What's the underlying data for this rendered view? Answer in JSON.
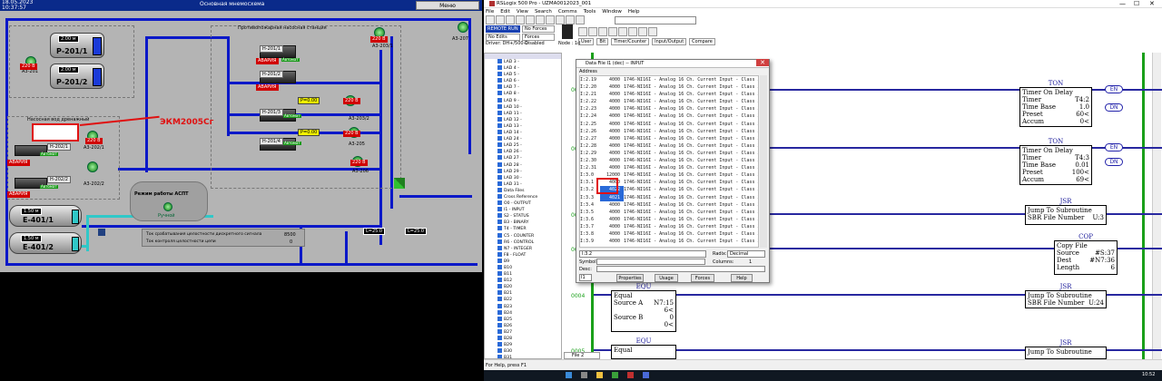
{
  "scada": {
    "date": "18.05.2023",
    "time": "10:37:57",
    "title": "Основная мнемосхема",
    "mode_btn": "Меню",
    "tanks": [
      {
        "name": "Р-201/1",
        "level": "2.00"
      },
      {
        "name": "Р-201/2",
        "level": "2.00"
      },
      {
        "name": "Е-401/1",
        "level": "1.50"
      },
      {
        "name": "Е-401/2",
        "level": "1.50"
      }
    ],
    "tank_unit": "м",
    "station_title": "Противопожарная насосная станция",
    "drain_title": "Насосная вод дренажный",
    "annotation": "ЭКМ2005Сг",
    "alarm": "АВАРИЯ",
    "auto": "Автомат",
    "mode_label": "Режим работы АСПТ",
    "mode_value": "Ручной",
    "info1_label": "Ток срабатывания целостности дискретного сигнала",
    "info1_value": "8500",
    "info2_label": "Ток контроля целостности цепи",
    "info2_value": "0",
    "pumps": [
      "А3-201",
      "А3-202/1",
      "А3-202/2",
      "А3-203/1",
      "А3-203/2",
      "А3-205",
      "А3-206",
      "А3-207"
    ],
    "motors": [
      "Н-201/1",
      "Н-201/2",
      "Н-201/3",
      "Н-201/4",
      "Н-202/1",
      "Н-202/2"
    ],
    "pressure": [
      "Р=0.00",
      "Р=0.00"
    ],
    "flows": [
      "L=25.0",
      "L=25.0"
    ]
  },
  "rsl": {
    "title": "RSLogix 500 Pro - UZMA0012023_001",
    "menu": [
      "File",
      "Edit",
      "View",
      "Search",
      "Comms",
      "Tools",
      "Window",
      "Help"
    ],
    "status": [
      "REMOTE RUN",
      "No Edits",
      "Driver: DH+/500-1"
    ],
    "forces": [
      "No Forces",
      "Forces Disabled"
    ],
    "node": "Node : 1d",
    "tabs": [
      "User",
      "Bit",
      "Timer/Counter",
      "Input/Output",
      "Compare"
    ],
    "tree": [
      "LAD 3 -",
      "LAD 4 -",
      "LAD 5 -",
      "LAD 6 -",
      "LAD 7 -",
      "LAD 8 -",
      "LAD 9 -",
      "LAD 10 -",
      "LAD 11 -",
      "LAD 12 -",
      "LAD 13 -",
      "LAD 14 -",
      "LAD 24 -",
      "LAD 25 -",
      "LAD 26 -",
      "LAD 27 -",
      "LAD 28 -",
      "LAD 29 -",
      "LAD 30 -",
      "LAD 31 -",
      "Data Files",
      "Cross Reference",
      "O0 - OUTPUT",
      "I1 - INPUT",
      "S2 - STATUS",
      "B3 - BINARY",
      "T4 - TIMER",
      "C5 - COUNTER",
      "R6 - CONTROL",
      "N7 - INTEGER",
      "F8 - FLOAT",
      "B9",
      "B10",
      "B11",
      "B12",
      "B20",
      "B21",
      "B22",
      "B23",
      "B24",
      "B25",
      "B26",
      "B27",
      "B28",
      "B29",
      "B30",
      "B31",
      "F32",
      "F33",
      "F34"
    ],
    "help": "For Help, press F1",
    "tab_name": "File 2",
    "rung_nums": [
      "0000",
      "0001",
      "0002",
      "0003",
      "0004",
      "0005"
    ],
    "instructions": {
      "ton1": {
        "title": "TON",
        "name": "Timer On Delay",
        "timer": "T4:2",
        "base": "1.0",
        "preset": "60<",
        "accum": "0<"
      },
      "ton2": {
        "title": "TON",
        "name": "Timer On Delay",
        "timer": "T4:3",
        "base": "0.01",
        "preset": "100<",
        "accum": "69<"
      },
      "jsr1": {
        "title": "JSR",
        "name": "Jump To Subroutine",
        "sbr": "U:3"
      },
      "cop": {
        "title": "COP",
        "name": "Copy File",
        "source": "#S:37",
        "dest": "#N7:36",
        "length": "6"
      },
      "equ1": {
        "title": "EQU",
        "name": "Equal",
        "srcA": "N7:15",
        "srcAval": "6<",
        "srcB": "0",
        "srcBval": "0<"
      },
      "jsr2": {
        "title": "JSR",
        "name": "Jump To Subroutine",
        "sbr": "U:24"
      },
      "equ2": {
        "title": "EQU",
        "name": "Equal"
      },
      "jsr3": {
        "title": "JSR",
        "name": "Jump To Subroutine"
      }
    },
    "labels": {
      "timer": "Timer",
      "base": "Time Base",
      "preset": "Preset",
      "accum": "Accum",
      "sbr": "SBR File Number",
      "source": "Source",
      "dest": "Dest",
      "length": "Length",
      "srcA": "Source A",
      "srcB": "Source B",
      "en": "EN",
      "dn": "DN"
    },
    "dialog": {
      "title": "Data File I1 (dec) -- INPUT",
      "header": "Address",
      "rows": [
        [
          "I:2.19",
          "4000",
          "1746-NI16I - Analog 16 Ch. Current Input - Class 3"
        ],
        [
          "I:2.20",
          "4000",
          "1746-NI16I - Analog 16 Ch. Current Input - Class 3"
        ],
        [
          "I:2.21",
          "4000",
          "1746-NI16I - Analog 16 Ch. Current Input - Class 3"
        ],
        [
          "I:2.22",
          "4000",
          "1746-NI16I - Analog 16 Ch. Current Input - Class 3"
        ],
        [
          "I:2.23",
          "4000",
          "1746-NI16I - Analog 16 Ch. Current Input - Class 3"
        ],
        [
          "I:2.24",
          "4000",
          "1746-NI16I - Analog 16 Ch. Current Input - Class 3"
        ],
        [
          "I:2.25",
          "4000",
          "1746-NI16I - Analog 16 Ch. Current Input - Class 3"
        ],
        [
          "I:2.26",
          "4000",
          "1746-NI16I - Analog 16 Ch. Current Input - Class 3"
        ],
        [
          "I:2.27",
          "4000",
          "1746-NI16I - Analog 16 Ch. Current Input - Class 3"
        ],
        [
          "I:2.28",
          "4000",
          "1746-NI16I - Analog 16 Ch. Current Input - Class 3"
        ],
        [
          "I:2.29",
          "4000",
          "1746-NI16I - Analog 16 Ch. Current Input - Class 3"
        ],
        [
          "I:2.30",
          "4000",
          "1746-NI16I - Analog 16 Ch. Current Input - Class 3"
        ],
        [
          "I:2.31",
          "4000",
          "1746-NI16I - Analog 16 Ch. Current Input - Class 3"
        ],
        [
          "I:3.0",
          "12000",
          "1746-NI16I - Analog 16 Ch. Current Input - Class 3"
        ],
        [
          "I:3.1",
          "4000",
          "1746-NI16I - Analog 16 Ch. Current Input - Class 3"
        ],
        [
          "I:3.2",
          "4022",
          "1746-NI16I - Analog 16 Ch. Current Input - Class 3"
        ],
        [
          "I:3.3",
          "4021",
          "1746-NI16I - Analog 16 Ch. Current Input - Class 3"
        ],
        [
          "I:3.4",
          "4000",
          "1746-NI16I - Analog 16 Ch. Current Input - Class 3"
        ],
        [
          "I:3.5",
          "4000",
          "1746-NI16I - Analog 16 Ch. Current Input - Class 3"
        ],
        [
          "I:3.6",
          "4000",
          "1746-NI16I - Analog 16 Ch. Current Input - Class 3"
        ],
        [
          "I:3.7",
          "4000",
          "1746-NI16I - Analog 16 Ch. Current Input - Class 3"
        ],
        [
          "I:3.8",
          "4000",
          "1746-NI16I - Analog 16 Ch. Current Input - Class 3"
        ],
        [
          "I:3.9",
          "4000",
          "1746-NI16I - Analog 16 Ch. Current Input - Class 3"
        ]
      ],
      "address": "I:3.2",
      "radix_label": "Radix:",
      "radix": "Decimal",
      "symbol_label": "Symbol:",
      "columns_label": "Columns:",
      "columns": "1",
      "desc_label": "Desc:",
      "file_label": "I1",
      "buttons": [
        "Properties",
        "Usage",
        "Forces",
        "Help"
      ]
    },
    "clock": "10:52"
  }
}
